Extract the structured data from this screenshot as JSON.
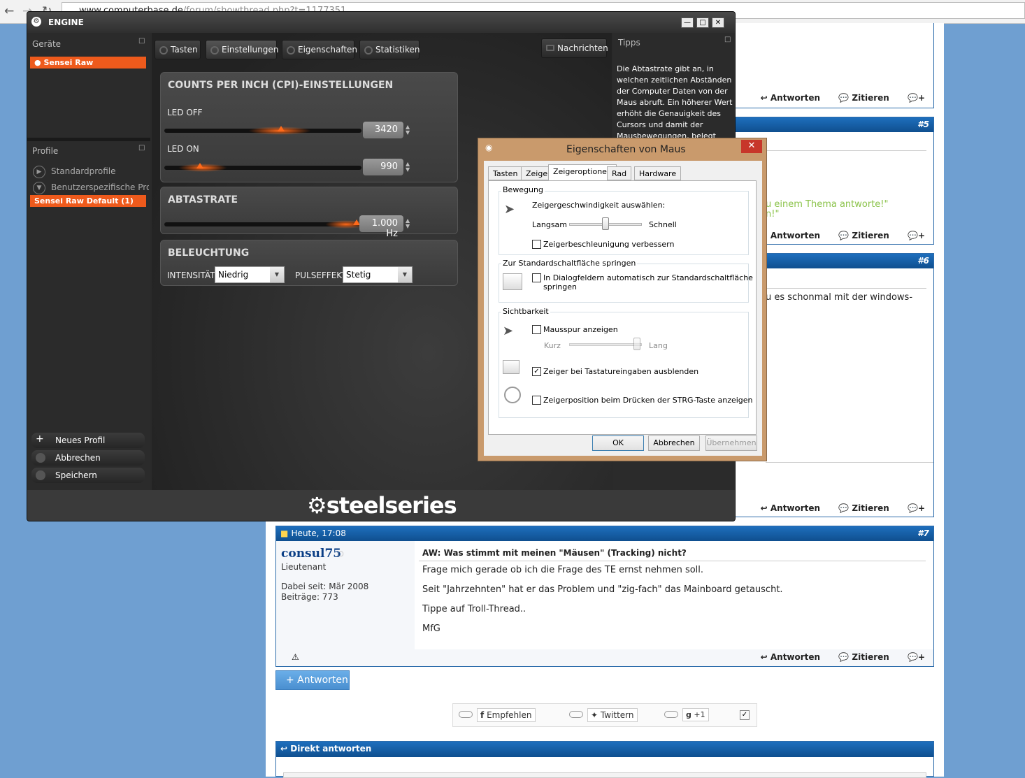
{
  "browser": {
    "url_host": "www.computerbase.de",
    "url_path": "/forum/showthread.php?t=1177351"
  },
  "forum": {
    "actions": {
      "reply": "Antworten",
      "quote": "Zitieren"
    },
    "post5_num": "#5",
    "post5_snippet_1": "u einem Thema antworte!\"",
    "post5_snippet_2": "n!\"",
    "post6_num": "#6",
    "post6_snippet": "u es schonmal mit der windows-",
    "post7": {
      "date": "Heute, 17:08",
      "num": "#7",
      "author": "consul75",
      "rank": "Lieutenant",
      "joined": "Dabei seit: Mär 2008",
      "posts": "Beiträge: 773",
      "title": "AW: Was stimmt mit meinen \"Mäusen\" (Tracking) nicht?",
      "lines": [
        "Frage mich gerade ob ich die Frage des TE ernst nehmen soll.",
        "Seit \"Jahrzehnten\" hat er das Problem und \"zig-fach\" das Mainboard getauscht.",
        "Tippe auf Troll-Thread..",
        "MfG"
      ]
    },
    "reply_button": "+ Antworten",
    "social": {
      "recommend": "Empfehlen",
      "twitter": "Twittern",
      "gplus": "+1"
    },
    "direct_reply": "Direkt antworten"
  },
  "engine": {
    "title": "ENGINE",
    "devices_label": "Geräte",
    "device_selected": "Sensei Raw",
    "profiles_label": "Profile",
    "profile_items": [
      "Standardprofile",
      "Benutzerspezifische Pro"
    ],
    "profile_selected": "Sensei Raw Default (1)",
    "buttons": {
      "new_profile": "Neues Profil",
      "cancel": "Abbrechen",
      "save": "Speichern"
    },
    "tabs": [
      "Tasten",
      "Einstellungen",
      "Eigenschaften",
      "Statistiken"
    ],
    "messages": "Nachrichten",
    "tips_label": "Tipps",
    "tips_text": "Die Abtastrate gibt an, in welchen zeitlichen Abständen der Computer Daten von der Maus abruft.  Ein höherer Wert erhöht die Genauigkeit des Cursors und damit der Mausbewegungen, belegt aber",
    "cpi": {
      "title": "COUNTS PER INCH (CPI)-EINSTELLUNGEN",
      "led_off_label": "LED OFF",
      "led_off_value": "3420",
      "led_on_label": "LED ON",
      "led_on_value": "990"
    },
    "abtastrate": {
      "title": "ABTASTRATE",
      "value": "1.000 Hz"
    },
    "beleuchtung": {
      "title": "BELEUCHTUNG",
      "intensity_label": "INTENSITÄT",
      "intensity_value": "Niedrig",
      "pulse_label": "PULSEFFEKT",
      "pulse_value": "Stetig"
    },
    "logo": "steelseries"
  },
  "dialog": {
    "title": "Eigenschaften von Maus",
    "tabs": [
      "Tasten",
      "Zeiger",
      "Zeigeroptionen",
      "Rad",
      "Hardware"
    ],
    "bewegung": {
      "label": "Bewegung",
      "speed_label": "Zeigergeschwindigkeit auswählen:",
      "slow": "Langsam",
      "fast": "Schnell",
      "enhance": "Zeigerbeschleunigung verbessern"
    },
    "snap": {
      "label": "Zur Standardschaltfläche springen",
      "text_1": "In Dialogfeldern automatisch zur Standardschaltfläche",
      "text_2": "springen"
    },
    "visibility": {
      "label": "Sichtbarkeit",
      "trails": "Mausspur anzeigen",
      "short": "Kurz",
      "long": "Lang",
      "hide": "Zeiger bei Tastatureingaben ausblenden",
      "ctrl": "Zeigerposition beim Drücken der STRG-Taste anzeigen"
    },
    "buttons": {
      "ok": "OK",
      "cancel": "Abbrechen",
      "apply": "Übernehmen"
    }
  }
}
